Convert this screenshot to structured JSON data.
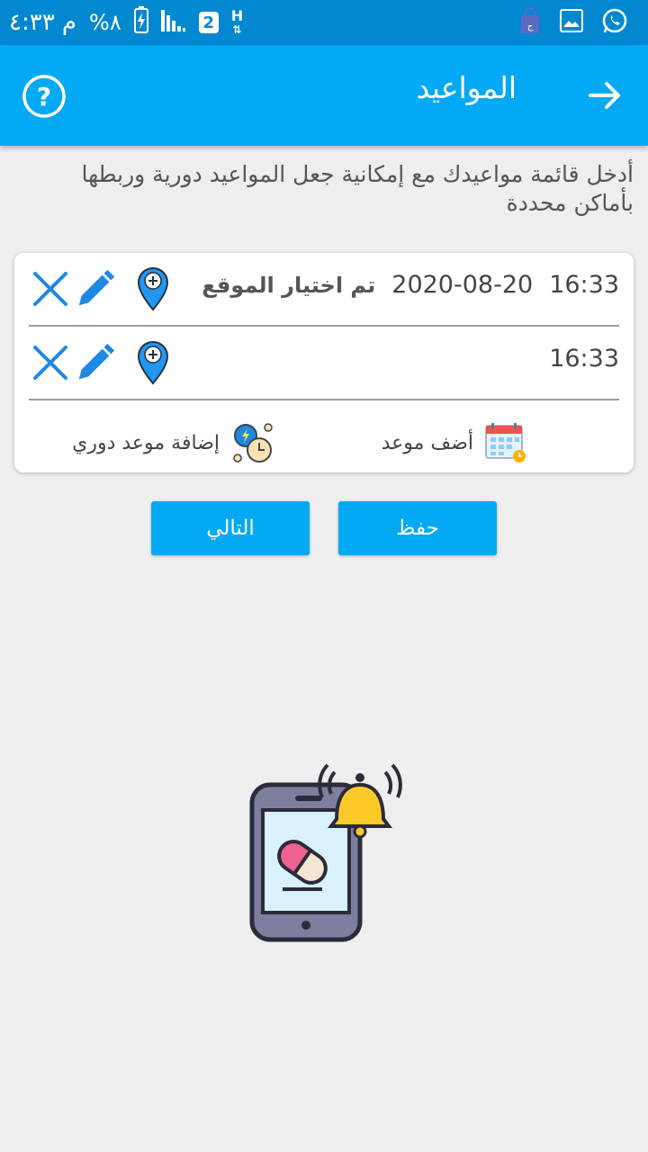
{
  "status_bar": {
    "time": "م ٤:٣٣",
    "battery": "%٨",
    "network_badge": "2",
    "data_type": "H"
  },
  "app_bar": {
    "title": "المواعيد",
    "back_icon": "arrow-forward-icon",
    "help_icon": "help-circle-icon"
  },
  "intro_text": "أدخل قائمة مواعيدك مع إمكانية جعل المواعيد دورية وربطها بأماكن محددة",
  "appointments": [
    {
      "time": "16:33",
      "date": "2020-08-20",
      "location_label": "تم اختيار الموقع"
    },
    {
      "time": "16:33",
      "date": "",
      "location_label": ""
    }
  ],
  "actions": {
    "add_appointment": "أضف موعد",
    "add_periodic": "إضافة موعد دوري"
  },
  "buttons": {
    "save": "حفظ",
    "next": "التالي"
  },
  "colors": {
    "primary": "#03a9f4",
    "primary_dark": "#0288d1",
    "background": "#eeeeee"
  }
}
